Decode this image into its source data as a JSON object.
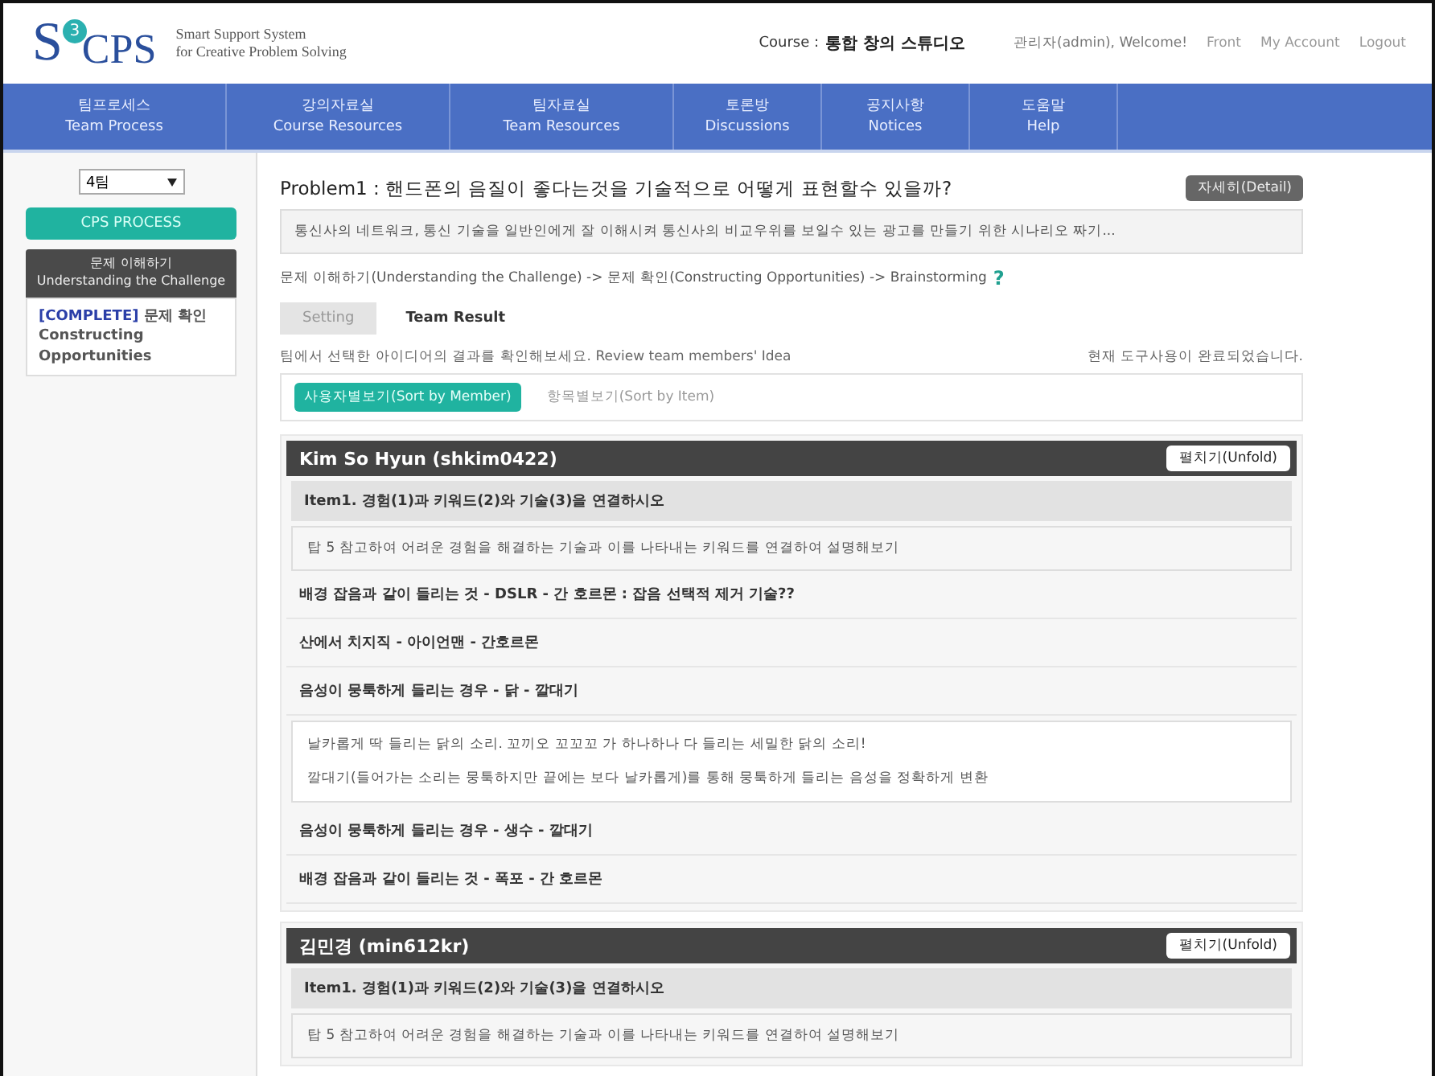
{
  "header": {
    "logo": {
      "letter": "S",
      "badge": "3",
      "name": "CPS",
      "tagline": [
        "Smart Support System",
        "for Creative Problem Solving"
      ]
    },
    "course_label": "Course :",
    "course_name": "통합 창의 스튜디오",
    "user_links": [
      {
        "label": "관리자(admin), Welcome!",
        "kind": "text"
      },
      {
        "label": "Front",
        "kind": "link"
      },
      {
        "label": "My Account",
        "kind": "link"
      },
      {
        "label": "Logout",
        "kind": "link"
      }
    ]
  },
  "nav": [
    {
      "ko": "팀프로세스",
      "en": "Team Process"
    },
    {
      "ko": "강의자료실",
      "en": "Course Resources"
    },
    {
      "ko": "팀자료실",
      "en": "Team Resources"
    },
    {
      "ko": "토론방",
      "en": "Discussions"
    },
    {
      "ko": "공지사항",
      "en": "Notices"
    },
    {
      "ko": "도움말",
      "en": "Help"
    }
  ],
  "sidebar": {
    "team_select": "4팀",
    "process_button": "CPS PROCESS",
    "steps": [
      {
        "kind": "header",
        "ko": "문제 이해하기",
        "en": "Understanding the Challenge"
      },
      {
        "kind": "current",
        "status": "[COMPLETE]",
        "ko": "문제 확인",
        "en": "Constructing Opportunities"
      }
    ]
  },
  "problem": {
    "title": "Problem1 : 핸드폰의 음질이 좋다는것을 기술적으로 어떻게 표현할수 있을까?",
    "detail_button": "자세히(Detail)",
    "description": "통신사의 네트워크, 통신 기술을 일반인에게 잘 이해시켜 통신사의 비교우위를 보일수 있는 광고를 만들기 위한 시나리오 짜기...",
    "breadcrumb": "문제 이해하기(Understanding the Challenge) -> 문제 확인(Constructing Opportunities) -> Brainstorming",
    "help": "?"
  },
  "tabs": [
    {
      "label": "Setting",
      "selected": false
    },
    {
      "label": "Team Result",
      "selected": true
    }
  ],
  "hint": "팀에서 선택한 아이디어의 결과를 확인해보세요. Review team members' Idea",
  "status": "현재 도구사용이 완료되었습니다.",
  "sort_buttons": [
    {
      "label": "사용자별보기(Sort by Member)",
      "selected": true
    },
    {
      "label": "항목별보기(Sort by Item)",
      "selected": false
    }
  ],
  "members": [
    {
      "name": "Kim So Hyun (shkim0422)",
      "unfold_button": "펼치기(Unfold)",
      "items": [
        {
          "title": "Item1. 경험(1)과 키워드(2)와 기술(3)을 연결하시오",
          "description": "탑 5 참고하여 어려운 경험을 해결하는 기술과 이를 나타내는 키워드를 연결하여 설명해보기",
          "answers": [
            {
              "text": "배경 잡음과 같이 들리는 것 - DSLR - 간 호르몬 : 잡음 선택적 제거 기술??"
            },
            {
              "text": "산에서 치지직 - 아이언맨 - 간호르몬"
            },
            {
              "text": "음성이 뭉툭하게 들리는 경우 - 닭 - 깔대기",
              "notes": [
                "날카롭게 딱 들리는 닭의 소리. 꼬끼오 꼬꼬꼬 가 하나하나 다 들리는 세밀한 닭의 소리!",
                "깔대기(들어가는 소리는 뭉툭하지만 끝에는 보다 날카롭게)를 통해 뭉툭하게 들리는 음성을 정확하게 변환"
              ]
            },
            {
              "text": "음성이 뭉툭하게 들리는 경우 - 생수 - 깔대기"
            },
            {
              "text": "배경 잡음과 같이 들리는 것 - 폭포 - 간 호르몬"
            }
          ]
        }
      ]
    },
    {
      "name": "김민경 (min612kr)",
      "unfold_button": "펼치기(Unfold)",
      "items": [
        {
          "title": "Item1. 경험(1)과 키워드(2)와 기술(3)을 연결하시오",
          "description": "탑 5 참고하여 어려운 경험을 해결하는 기술과 이를 나타내는 키워드를 연결하여 설명해보기"
        }
      ]
    }
  ]
}
